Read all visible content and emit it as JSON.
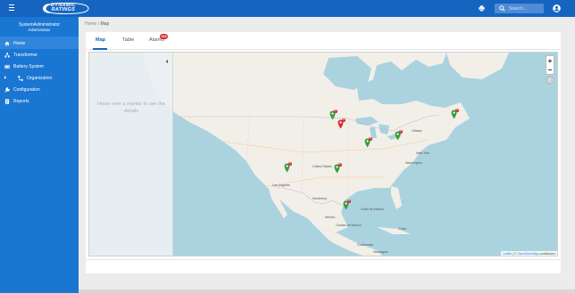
{
  "header": {
    "logo_line1": "DYNAMIC",
    "logo_line2": "RATINGS",
    "search_placeholder": "Search...",
    "icons": [
      "menu-icon",
      "printer-icon",
      "search-icon",
      "user-icon"
    ]
  },
  "sidebar": {
    "user_name": "SystemAdministrator",
    "user_role": "Administrator",
    "items": [
      {
        "label": "Home",
        "icon": "home-icon",
        "active": true
      },
      {
        "label": "Transformer",
        "icon": "transformer-icon"
      },
      {
        "label": "Battery System",
        "icon": "battery-icon"
      },
      {
        "label": "Organization",
        "icon": "organization-icon"
      },
      {
        "label": "Configuration",
        "icon": "wrench-icon"
      },
      {
        "label": "Reports",
        "icon": "report-icon"
      }
    ]
  },
  "breadcrumb": {
    "home": "Home",
    "separator": "/",
    "current": "Map"
  },
  "tabs": [
    {
      "label": "Map",
      "active": true
    },
    {
      "label": "Table"
    },
    {
      "label": "Alarms",
      "badge": "103"
    }
  ],
  "map": {
    "info_text": "Hover over a marker to see the details",
    "zoom_in": "+",
    "zoom_out": "−",
    "attribution_leaflet": "Leaflet",
    "attribution_sep": " | © ",
    "attribution_osm": "OpenStreetMap",
    "attribution_rest": " contributors",
    "labels": [
      "Ottawa",
      "New York",
      "Washington",
      "Los Angeles",
      "México",
      "Ciudad de México",
      "Golfo de México",
      "United States",
      "Monterrey",
      "Cuba",
      "Guatemala",
      "Nicaragua"
    ],
    "markers": [
      {
        "name": "marker-montana",
        "badge": "2"
      },
      {
        "name": "marker-dakota",
        "badge": "2"
      },
      {
        "name": "marker-illinois",
        "badge": "2"
      },
      {
        "name": "marker-michigan",
        "badge": "2"
      },
      {
        "name": "marker-quebec",
        "badge": "2"
      },
      {
        "name": "marker-arizona",
        "badge": "2"
      },
      {
        "name": "marker-oklahoma",
        "badge": "2"
      },
      {
        "name": "marker-texas",
        "badge": "2"
      }
    ]
  },
  "colors": {
    "primary": "#1565c0",
    "sidebar": "#1976d2",
    "sidebar_active": "#2f86dc",
    "badge": "#d32f2f",
    "marker": "#3d9a3d",
    "water": "#aad3df",
    "land": "#f2efe9"
  }
}
